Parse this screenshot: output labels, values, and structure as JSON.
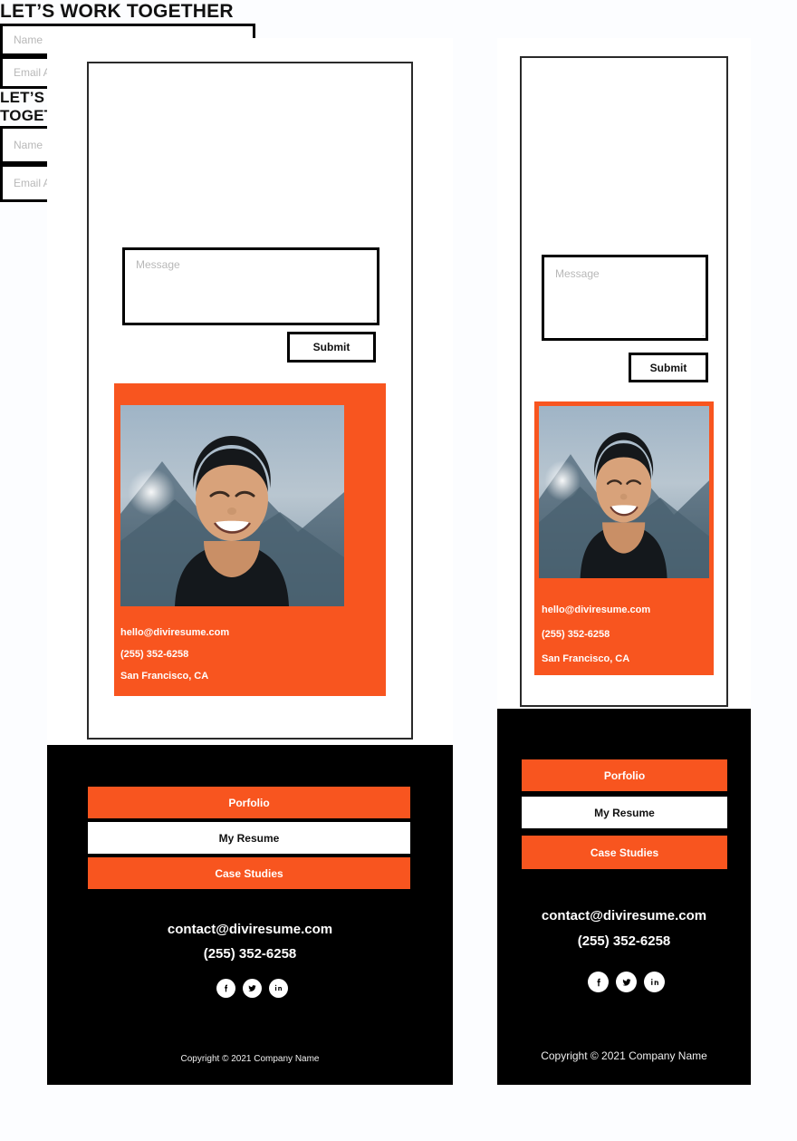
{
  "page": {
    "background": "#fcfdff",
    "accent_color": "#f8551f",
    "dark_color": "#000000"
  },
  "form": {
    "heading": "LET’S WORK TOGETHER",
    "name_placeholder": "Name",
    "email_placeholder": "Email Address",
    "message_placeholder": "Message",
    "submit_label": "Submit"
  },
  "contact_card": {
    "email": "hello@diviresume.com",
    "phone": "(255) 352-6258",
    "location": "San Francisco, CA"
  },
  "nav_buttons": [
    {
      "label": "Porfolio",
      "style": "orange"
    },
    {
      "label": "My Resume",
      "style": "white"
    },
    {
      "label": "Case Studies",
      "style": "orange"
    }
  ],
  "footer": {
    "email": "contact@diviresume.com",
    "phone": "(255) 352-6258",
    "copyright": "Copyright © 2021 Company Name",
    "social": [
      {
        "name": "facebook-icon",
        "label": "Facebook"
      },
      {
        "name": "twitter-icon",
        "label": "Twitter"
      },
      {
        "name": "linkedin-icon",
        "label": "LinkedIn"
      }
    ]
  }
}
